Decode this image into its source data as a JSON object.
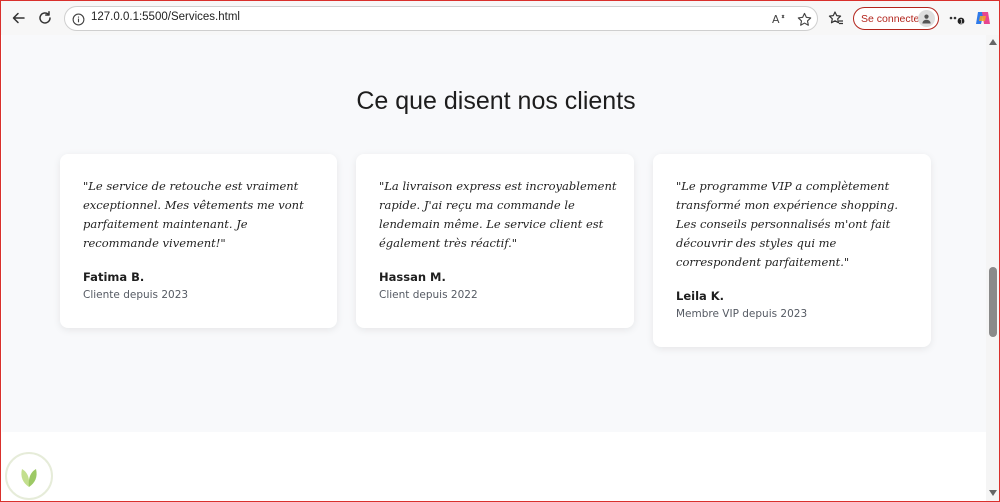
{
  "browser": {
    "url_host": "127.0.0.1",
    "url_rest": ":5500/Services.html",
    "signin_label": "Se connecter",
    "icons": {
      "back": "back-arrow-icon",
      "reload": "reload-icon",
      "info": "info-icon",
      "read_aloud": "read-aloud-icon",
      "favorite": "star-icon",
      "favorites": "favorites-icon",
      "profile": "profile-icon",
      "more": "more-icon",
      "copilot": "copilot-icon"
    },
    "accent_color": "#b3261e"
  },
  "testimonials": {
    "title": "Ce que disent nos clients",
    "cards": [
      {
        "quote": "\"Le service de retouche est vraiment exceptionnel. Mes vêtements me vont parfaitement maintenant. Je recommande vivement!\"",
        "author": "Fatima B.",
        "since": "Cliente depuis 2023"
      },
      {
        "quote": "\"La livraison express est incroyablement rapide. J'ai reçu ma commande le lendemain même. Le service client est également très réactif.\"",
        "author": "Hassan M.",
        "since": "Client depuis 2022"
      },
      {
        "quote": "\"Le programme VIP a complètement transformé mon expérience shopping. Les conseils personnalisés m'ont fait découvrir des styles qui me correspondent parfaitement.\"",
        "author": "Leila K.",
        "since": "Membre VIP depuis 2023"
      }
    ]
  },
  "colors": {
    "section_bg": "#f8f9fb",
    "card_bg": "#ffffff",
    "text": "#1f1f1f",
    "muted": "#555a63",
    "frame_border": "#d9302c"
  }
}
